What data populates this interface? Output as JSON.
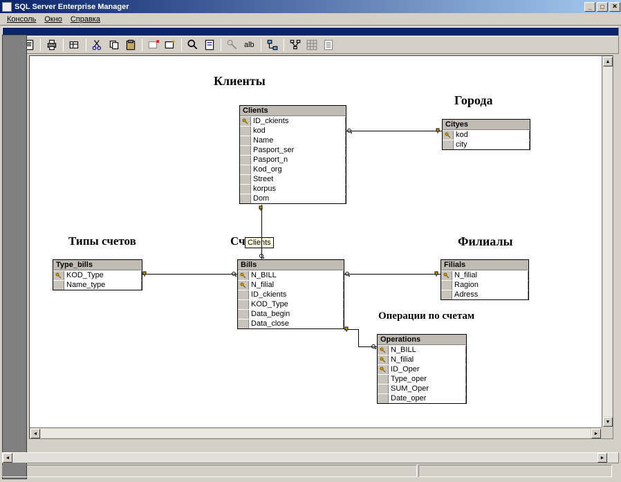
{
  "window": {
    "title": "SQL Server Enterprise Manager"
  },
  "menu": {
    "console": "Консоль",
    "window": "Окно",
    "help": "Справка"
  },
  "toolbar": {
    "alb": "alb"
  },
  "labels": {
    "clients": "Клиенты",
    "cities": "Города",
    "bill_types": "Типы счетов",
    "sc": "Сч",
    "branches": "Филиалы",
    "operations": "Операции по счетам"
  },
  "tooltip": {
    "text": "Clients"
  },
  "tables": {
    "clients": {
      "name": "Clients",
      "cols": [
        {
          "key": true,
          "name": "ID_ckients"
        },
        {
          "key": false,
          "name": "kod"
        },
        {
          "key": false,
          "name": "Name"
        },
        {
          "key": false,
          "name": "Pasport_ser"
        },
        {
          "key": false,
          "name": "Pasport_n"
        },
        {
          "key": false,
          "name": "Kod_org"
        },
        {
          "key": false,
          "name": "Street"
        },
        {
          "key": false,
          "name": "korpus"
        },
        {
          "key": false,
          "name": "Dom"
        }
      ]
    },
    "cityes": {
      "name": "Cityes",
      "cols": [
        {
          "key": true,
          "name": "kod"
        },
        {
          "key": false,
          "name": "city"
        }
      ]
    },
    "type_bills": {
      "name": "Type_bills",
      "cols": [
        {
          "key": true,
          "name": "KOD_Type"
        },
        {
          "key": false,
          "name": "Name_type"
        }
      ]
    },
    "bills": {
      "name": "Bills",
      "cols": [
        {
          "key": true,
          "name": "N_BILL"
        },
        {
          "key": true,
          "name": "N_filial"
        },
        {
          "key": false,
          "name": "ID_ckients"
        },
        {
          "key": false,
          "name": "KOD_Type"
        },
        {
          "key": false,
          "name": "Data_begin"
        },
        {
          "key": false,
          "name": "Data_close"
        }
      ]
    },
    "filials": {
      "name": "Filials",
      "cols": [
        {
          "key": true,
          "name": "N_filial"
        },
        {
          "key": false,
          "name": "Ragion"
        },
        {
          "key": false,
          "name": "Adress"
        }
      ]
    },
    "operations": {
      "name": "Operations",
      "cols": [
        {
          "key": true,
          "name": "N_BILL"
        },
        {
          "key": true,
          "name": "N_filial"
        },
        {
          "key": true,
          "name": "ID_Oper"
        },
        {
          "key": false,
          "name": "Type_oper"
        },
        {
          "key": false,
          "name": "SUM_Oper"
        },
        {
          "key": false,
          "name": "Date_oper"
        }
      ]
    }
  }
}
